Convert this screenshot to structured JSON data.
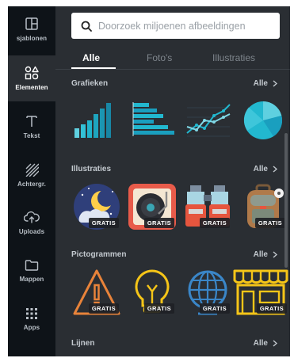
{
  "rail": {
    "items": [
      {
        "label": "sjablonen",
        "icon": "layout-icon"
      },
      {
        "label": "Elementen",
        "icon": "shapes-icon"
      },
      {
        "label": "Tekst",
        "icon": "text-icon"
      },
      {
        "label": "Achtergr.",
        "icon": "background-pattern-icon"
      },
      {
        "label": "Uploads",
        "icon": "cloud-upload-icon"
      },
      {
        "label": "Mappen",
        "icon": "folder-icon"
      },
      {
        "label": "Apps",
        "icon": "apps-grid-icon"
      }
    ],
    "active_index": 1
  },
  "search": {
    "placeholder": "Doorzoek miljoenen afbeeldingen"
  },
  "tabs": [
    {
      "label": "Alle",
      "active": true
    },
    {
      "label": "Foto's",
      "active": false
    },
    {
      "label": "Illustraties",
      "active": false
    }
  ],
  "sections": [
    {
      "title": "Grafieken",
      "see_all": "Alle",
      "items": [
        {
          "icon": "bar-chart-icon",
          "badge": ""
        },
        {
          "icon": "horizontal-bar-chart-icon",
          "badge": ""
        },
        {
          "icon": "line-chart-icon",
          "badge": ""
        },
        {
          "icon": "pie-chart-icon",
          "badge": ""
        }
      ]
    },
    {
      "title": "Illustraties",
      "see_all": "Alle",
      "items": [
        {
          "icon": "moon-night-illustration",
          "badge": "GRATIS"
        },
        {
          "icon": "record-player-illustration",
          "badge": "GRATIS"
        },
        {
          "icon": "binoculars-illustration",
          "badge": "GRATIS"
        },
        {
          "icon": "backpack-illustration",
          "badge": "GRATIS"
        }
      ]
    },
    {
      "title": "Pictogrammen",
      "see_all": "Alle",
      "items": [
        {
          "icon": "warning-icon",
          "badge": "GRATIS"
        },
        {
          "icon": "lightbulb-icon",
          "badge": "GRATIS"
        },
        {
          "icon": "globe-icon",
          "badge": "GRATIS"
        },
        {
          "icon": "storefront-icon",
          "badge": "GRATIS"
        }
      ]
    },
    {
      "title": "Lijnen",
      "see_all": "Alle",
      "items": []
    }
  ],
  "colors": {
    "rail_bg": "#0e1318",
    "panel_bg": "#2a2e33",
    "teal": "#22b8cf",
    "orange": "#e8833a",
    "yellow": "#f5c518",
    "blue": "#3a86c8"
  }
}
